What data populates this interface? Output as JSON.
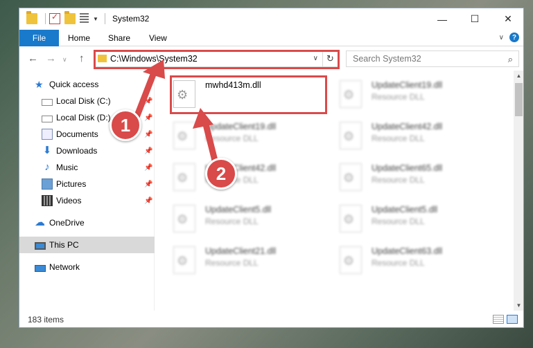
{
  "window": {
    "title": "System32",
    "minimize_glyph": "—",
    "maximize_glyph": "☐",
    "close_glyph": "✕"
  },
  "ribbon": {
    "tabs": [
      "File",
      "Home",
      "Share",
      "View"
    ],
    "expand_glyph": "∨",
    "help_glyph": "?"
  },
  "nav": {
    "back_glyph": "←",
    "forward_glyph": "→",
    "recent_glyph": "∨",
    "up_glyph": "↑",
    "address": "C:\\Windows\\System32",
    "address_dropdown_glyph": "∨",
    "refresh_glyph": "↻",
    "search_placeholder": "Search System32",
    "search_glyph": "⌕"
  },
  "sidebar": {
    "items": [
      {
        "label": "Quick access",
        "icon": "star-icon"
      },
      {
        "label": "Local Disk (C:)",
        "icon": "disk-icon",
        "pinned": true
      },
      {
        "label": "Local Disk (D:)",
        "icon": "disk-icon",
        "pinned": true
      },
      {
        "label": "Documents",
        "icon": "documents-icon",
        "pinned": true
      },
      {
        "label": "Downloads",
        "icon": "download-icon",
        "pinned": true
      },
      {
        "label": "Music",
        "icon": "music-icon",
        "pinned": true
      },
      {
        "label": "Pictures",
        "icon": "pictures-icon",
        "pinned": true
      },
      {
        "label": "Videos",
        "icon": "videos-icon",
        "pinned": true
      },
      {
        "label": "OneDrive",
        "icon": "cloud-icon"
      },
      {
        "label": "This PC",
        "icon": "computer-icon",
        "selected": true
      },
      {
        "label": "Network",
        "icon": "network-icon"
      }
    ],
    "pin_glyph": "📌"
  },
  "files": [
    {
      "name": "mwhd413m.dll",
      "type": "",
      "blurred": false
    },
    {
      "name": "UpdateClient19.dll",
      "type": "Resource DLL",
      "blurred": true
    },
    {
      "name": "UpdateClient19.dll",
      "type": "Resource DLL",
      "blurred": true
    },
    {
      "name": "UpdateClient42.dll",
      "type": "Resource DLL",
      "blurred": true
    },
    {
      "name": "UpdateClient42.dll",
      "type": "Resource DLL",
      "blurred": true
    },
    {
      "name": "UpdateClient65.dll",
      "type": "Resource DLL",
      "blurred": true
    },
    {
      "name": "UpdateClient5.dll",
      "type": "Resource DLL",
      "blurred": true
    },
    {
      "name": "UpdateClient5.dll",
      "type": "Resource DLL",
      "blurred": true
    },
    {
      "name": "UpdateClient21.dll",
      "type": "Resource DLL",
      "blurred": true
    },
    {
      "name": "UpdateClient63.dll",
      "type": "Resource DLL",
      "blurred": true
    }
  ],
  "status": {
    "item_count": "183 items"
  },
  "annotations": {
    "step1": "1",
    "step2": "2",
    "color": "#d94a4a"
  },
  "colors": {
    "accent": "#1979ca",
    "selected": "#d9d9d9"
  }
}
